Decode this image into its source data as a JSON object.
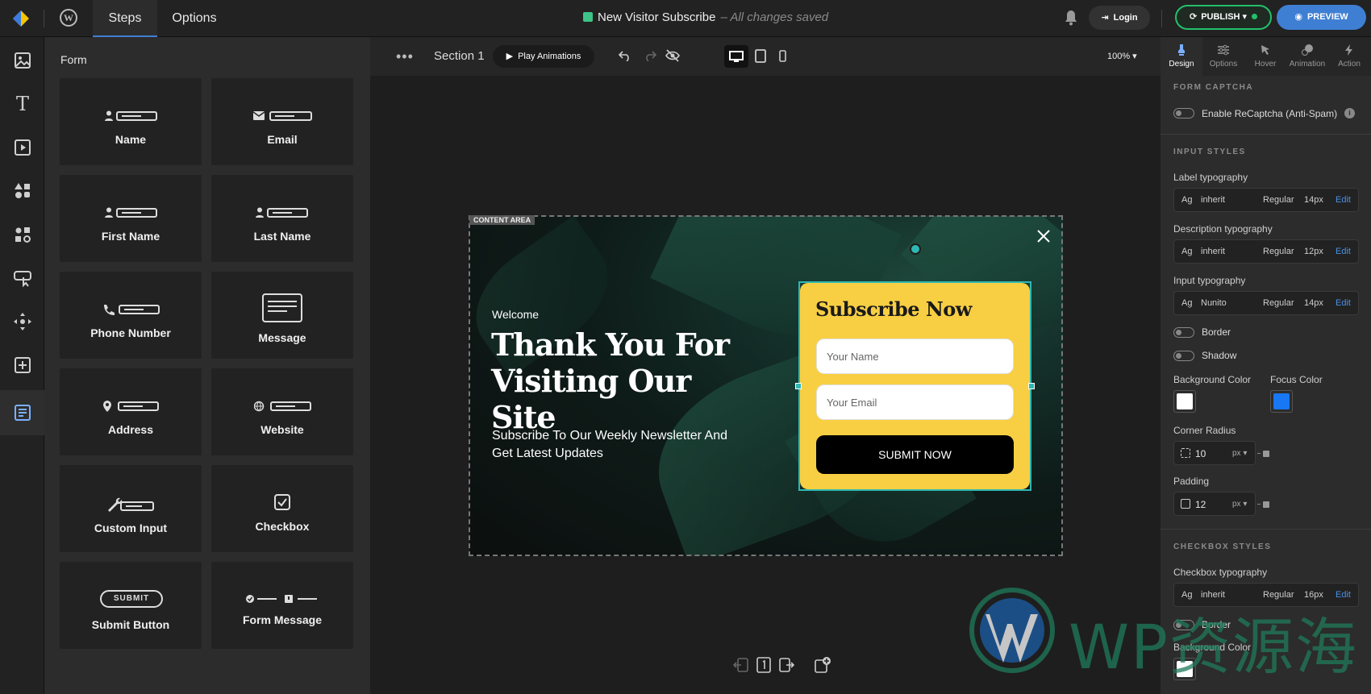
{
  "topbar": {
    "tabs": [
      {
        "label": "Steps"
      },
      {
        "label": "Options"
      }
    ],
    "doc_title": "New Visitor Subscribe",
    "save_status": "– All changes saved",
    "login_label": "Login",
    "publish_label": "PUBLISH",
    "preview_label": "PREVIEW",
    "accent": "#3f7fd3",
    "publish_color": "#23c06b"
  },
  "rail": {
    "icons": [
      "image-icon",
      "text-icon",
      "video-icon",
      "shapes-icon",
      "elements-icon",
      "button-icon",
      "move-icon",
      "add-icon",
      "form-icon"
    ]
  },
  "panel": {
    "title": "Form",
    "tiles": [
      {
        "label": "Name",
        "icon": "person-field-icon"
      },
      {
        "label": "Email",
        "icon": "email-field-icon"
      },
      {
        "label": "First Name",
        "icon": "person-field-icon"
      },
      {
        "label": "Last Name",
        "icon": "person-field-icon"
      },
      {
        "label": "Phone Number",
        "icon": "phone-field-icon"
      },
      {
        "label": "Message",
        "icon": "message-box-icon"
      },
      {
        "label": "Address",
        "icon": "location-field-icon"
      },
      {
        "label": "Website",
        "icon": "globe-field-icon"
      },
      {
        "label": "Custom Input",
        "icon": "wrench-field-icon"
      },
      {
        "label": "Checkbox",
        "icon": "checkbox-icon"
      },
      {
        "label": "Submit Button",
        "icon": "submit-pill-icon",
        "pill_text": "SUBMIT"
      },
      {
        "label": "Form Message",
        "icon": "form-message-icon"
      }
    ]
  },
  "canvas": {
    "section_label": "Section 1",
    "play_label": "Play Animations",
    "zoom": "100%",
    "content_tag": "CONTENT AREA",
    "popup": {
      "welcome": "Welcome",
      "title": "Thank You For Visiting Our Site",
      "subtitle": "Subscribe To Our Weekly Newsletter And Get Latest Updates",
      "form_heading": "Subscribe Now",
      "name_placeholder": "Your Name",
      "email_placeholder": "Your Email",
      "submit_label": "SUBMIT NOW",
      "card_color": "#f8cf43"
    }
  },
  "right": {
    "tabs": [
      {
        "label": "Design"
      },
      {
        "label": "Options"
      },
      {
        "label": "Hover"
      },
      {
        "label": "Animation"
      },
      {
        "label": "Action"
      }
    ],
    "captcha": {
      "header": "FORM CAPTCHA",
      "label": "Enable ReCaptcha (Anti-Spam)"
    },
    "input_styles": {
      "header": "INPUT STYLES",
      "label_typo": {
        "title": "Label typography",
        "ag": "Ag",
        "font": "inherit",
        "weight": "Regular",
        "size": "14px",
        "edit": "Edit"
      },
      "desc_typo": {
        "title": "Description typography",
        "ag": "Ag",
        "font": "inherit",
        "weight": "Regular",
        "size": "12px",
        "edit": "Edit"
      },
      "input_typo": {
        "title": "Input typography",
        "ag": "Ag",
        "font": "Nunito",
        "weight": "Regular",
        "size": "14px",
        "edit": "Edit"
      },
      "border_label": "Border",
      "shadow_label": "Shadow",
      "bg_color_label": "Background Color",
      "focus_color_label": "Focus Color",
      "bg_color": "#ffffff",
      "focus_color": "#1877f2",
      "radius_label": "Corner Radius",
      "radius_value": "10",
      "radius_unit": "px",
      "padding_label": "Padding",
      "padding_value": "12",
      "padding_unit": "px"
    },
    "checkbox_styles": {
      "header": "CHECKBOX STYLES",
      "typo": {
        "title": "Checkbox typography",
        "ag": "Ag",
        "font": "inherit",
        "weight": "Regular",
        "size": "16px",
        "edit": "Edit"
      },
      "border_label": "Border",
      "bg_color_label": "Background Color"
    }
  },
  "watermark": {
    "text": "WP资源海"
  }
}
